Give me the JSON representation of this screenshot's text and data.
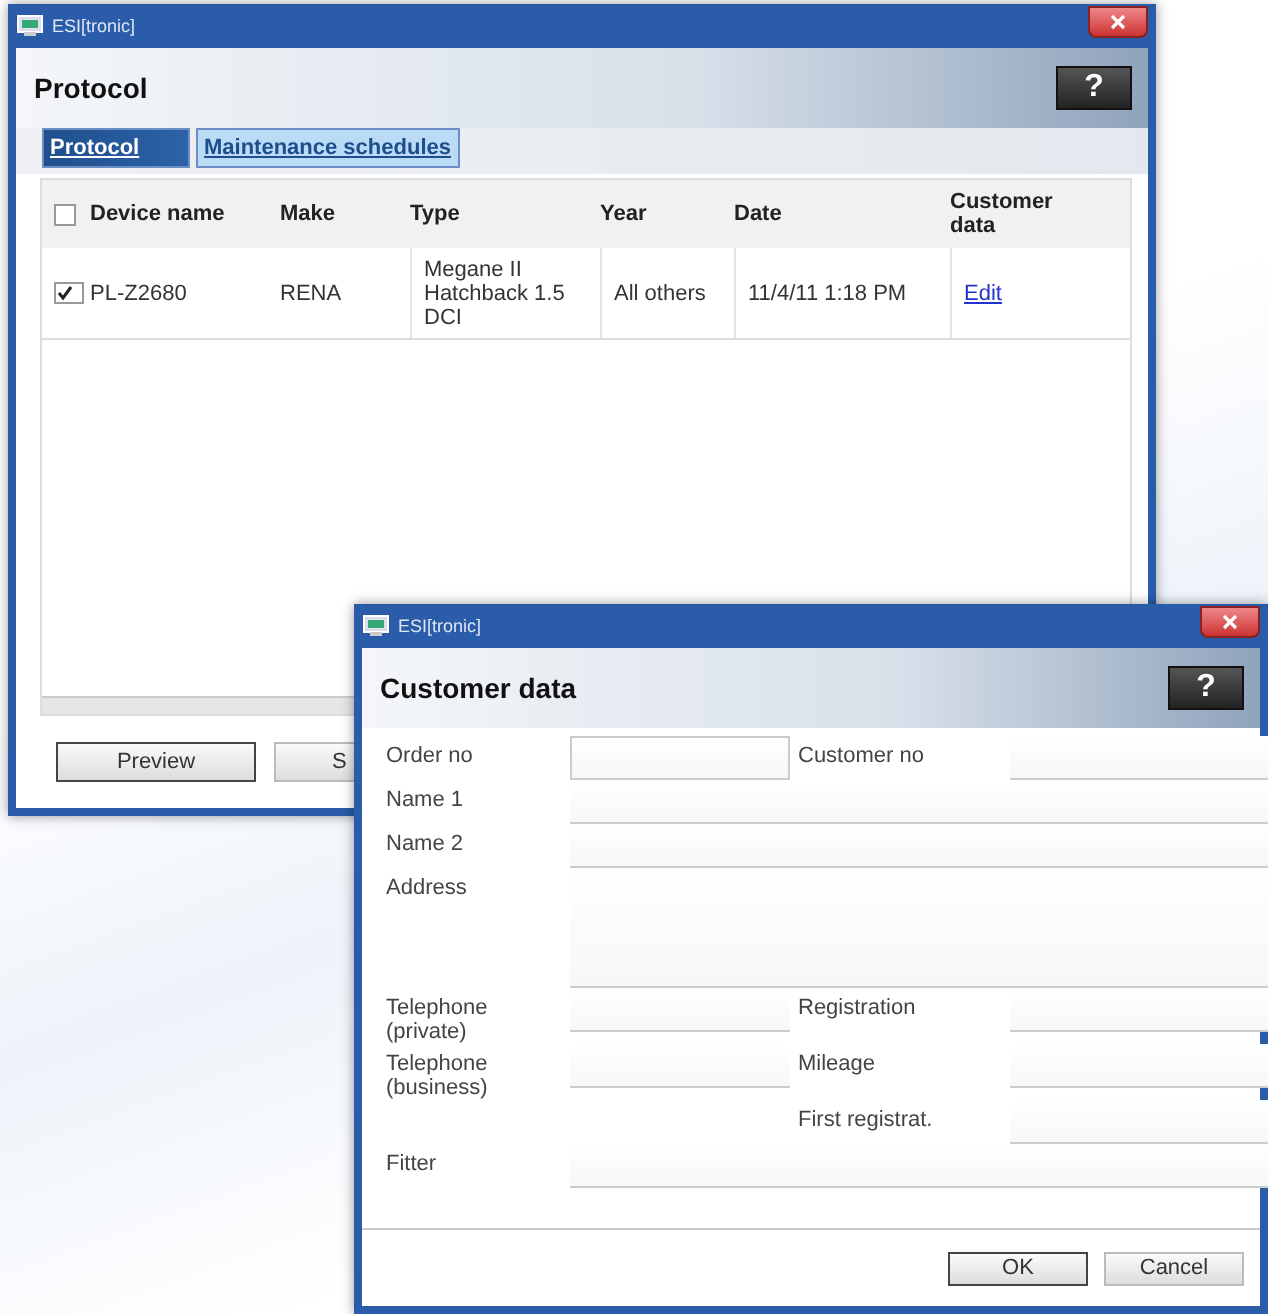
{
  "protocol_window": {
    "title": "ESI[tronic]",
    "heading": "Protocol",
    "help": "?",
    "tabs": [
      {
        "label": "Protocol",
        "selected": true
      },
      {
        "label": "Maintenance schedules",
        "selected": false
      }
    ],
    "table": {
      "select_all": {
        "checked": false
      },
      "columns": [
        "Device name",
        "Make",
        "Type",
        "Year",
        "Date",
        "Customer data"
      ],
      "rows": [
        {
          "checked": true,
          "cells": [
            "PL-Z2680",
            "RENA",
            "Megane II Hatchback 1.5 DCI",
            "All others",
            "11/4/11 1:18 PM"
          ],
          "link": "Edit"
        }
      ]
    },
    "buttons": [
      {
        "label": "Preview",
        "default": true
      },
      {
        "label": "S",
        "default": false
      }
    ]
  },
  "customer_window": {
    "title": "ESI[tronic]",
    "heading": "Customer data",
    "help": "?",
    "rows": [
      {
        "kind": "split",
        "labels": [
          "Order no",
          "Customer no"
        ]
      },
      {
        "kind": "wide",
        "labels": [
          "Name 1"
        ]
      },
      {
        "kind": "wide",
        "labels": [
          "Name 2"
        ]
      },
      {
        "kind": "tall",
        "labels": [
          "Address"
        ]
      },
      {
        "kind": "split",
        "labels": [
          "Telephone (private)",
          "Registration"
        ]
      },
      {
        "kind": "split",
        "labels": [
          "Telephone (business)",
          "Mileage"
        ]
      },
      {
        "kind": "right",
        "labels": [
          "First registrat."
        ]
      },
      {
        "kind": "wide",
        "labels": [
          "Fitter"
        ]
      }
    ],
    "buttons": [
      {
        "label": "OK",
        "default": true
      },
      {
        "label": "Cancel",
        "default": false
      }
    ]
  }
}
